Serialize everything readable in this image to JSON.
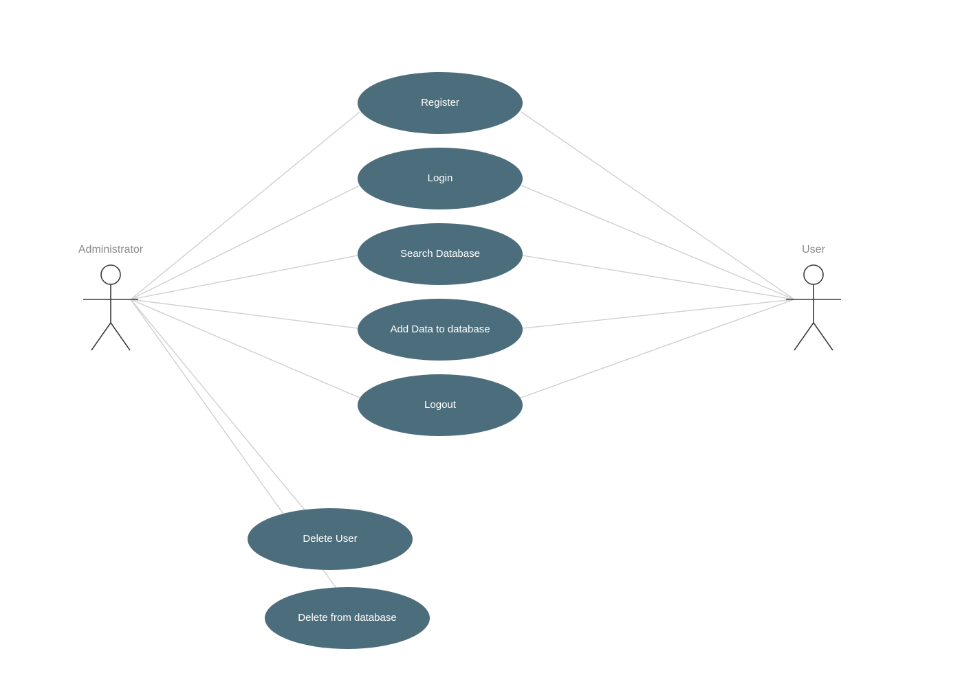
{
  "actors": {
    "admin": {
      "label": "Administrator"
    },
    "user": {
      "label": "User"
    }
  },
  "usecases": {
    "register": {
      "label": "Register"
    },
    "login": {
      "label": "Login"
    },
    "search": {
      "label": "Search Database"
    },
    "add": {
      "label": "Add Data to database"
    },
    "logout": {
      "label": "Logout"
    },
    "deleteUser": {
      "label": "Delete User"
    },
    "deleteFromDb": {
      "label": "Delete  from database"
    }
  },
  "colors": {
    "usecaseFill": "#4c6d7c",
    "connector": "#cfcfcf",
    "actorStroke": "#3a3a3a",
    "actorLabel": "#888a8c"
  }
}
